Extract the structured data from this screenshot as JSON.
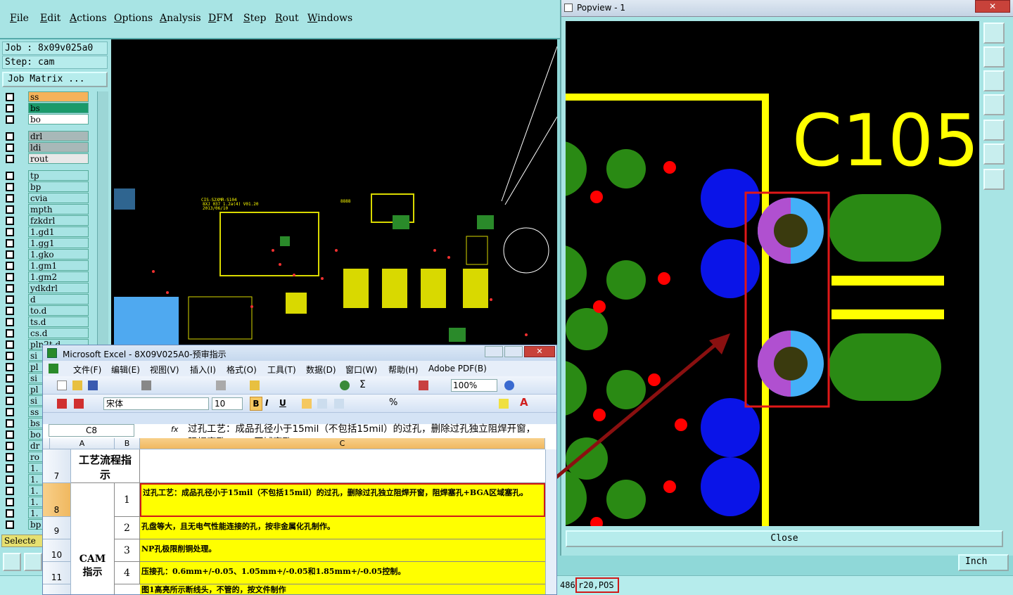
{
  "menu": [
    "File",
    "Edit",
    "Actions",
    "Options",
    "Analysis",
    "DFM",
    "Step",
    "Rout",
    "Windows"
  ],
  "job": {
    "job_label": "Job : 8x09v025a0",
    "step_label": "Step: cam",
    "matrix_button": "Job Matrix ..."
  },
  "layers": [
    {
      "name": "ss",
      "color": "#f5b25a"
    },
    {
      "name": "bs",
      "color": "#1a9a6a"
    },
    {
      "name": "bo",
      "color": "#ffffff"
    },
    {
      "name": "drl",
      "color": "#a8b8b8"
    },
    {
      "name": "ldi",
      "color": "#a8b8b8"
    },
    {
      "name": "rout",
      "color": "#e8e8e8"
    },
    {
      "name": "tp",
      "color": "#a8e4e4"
    },
    {
      "name": "bp",
      "color": "#a8e4e4"
    },
    {
      "name": "cvia",
      "color": "#a8e4e4"
    },
    {
      "name": "mpth",
      "color": "#a8e4e4"
    },
    {
      "name": "fzkdrl",
      "color": "#a8e4e4"
    },
    {
      "name": "1.gd1",
      "color": "#a8e4e4"
    },
    {
      "name": "1.gg1",
      "color": "#a8e4e4"
    },
    {
      "name": "1.gko",
      "color": "#a8e4e4"
    },
    {
      "name": "1.gm1",
      "color": "#a8e4e4"
    },
    {
      "name": "1.gm2",
      "color": "#a8e4e4"
    },
    {
      "name": "ydkdrl",
      "color": "#a8e4e4"
    },
    {
      "name": "d",
      "color": "#a8e4e4"
    },
    {
      "name": "to.d",
      "color": "#a8e4e4"
    },
    {
      "name": "ts.d",
      "color": "#a8e4e4"
    },
    {
      "name": "cs.d",
      "color": "#a8e4e4"
    },
    {
      "name": "pln2t.d",
      "color": "#a8e4e4"
    },
    {
      "name": "si",
      "color": "#a8e4e4"
    },
    {
      "name": "pl",
      "color": "#a8e4e4"
    },
    {
      "name": "si",
      "color": "#a8e4e4"
    },
    {
      "name": "pl",
      "color": "#a8e4e4"
    },
    {
      "name": "si",
      "color": "#a8e4e4"
    },
    {
      "name": "ss",
      "color": "#a8e4e4"
    },
    {
      "name": "bs",
      "color": "#a8e4e4"
    },
    {
      "name": "bo",
      "color": "#a8e4e4"
    },
    {
      "name": "dr",
      "color": "#a8e4e4"
    },
    {
      "name": "ro",
      "color": "#a8e4e4"
    },
    {
      "name": "1.",
      "color": "#a8e4e4"
    },
    {
      "name": "1.",
      "color": "#a8e4e4"
    },
    {
      "name": "1.",
      "color": "#a8e4e4"
    },
    {
      "name": "1.",
      "color": "#a8e4e4"
    },
    {
      "name": "1.",
      "color": "#a8e4e4"
    },
    {
      "name": "bp",
      "color": "#a8e4e4"
    }
  ],
  "selected_label": "Selecte",
  "popview": {
    "title": "Popview - 1",
    "label": "C105",
    "close": "Close",
    "units": "Inch"
  },
  "status": {
    "left": "486",
    "coord": "r20,POS"
  },
  "excel": {
    "title": "Microsoft Excel - 8X09V025A0-预审指示",
    "menu": [
      "文件(F)",
      "编辑(E)",
      "视图(V)",
      "插入(I)",
      "格式(O)",
      "工具(T)",
      "数据(D)",
      "窗口(W)",
      "帮助(H)",
      "Adobe PDF(B)"
    ],
    "zoom": "100%",
    "font": "宋体",
    "size": "10",
    "cellref": "C8",
    "fx": "fx",
    "formula": "过孔工艺：成品孔径小于15mil（不包括15mil）的过孔，删除过孔独立阻焊开窗，阻焊塞孔+BGA区域塞孔。",
    "cols": [
      "A",
      "B",
      "C"
    ],
    "header": "工艺流程指示",
    "group": "CAM指示",
    "rows": [
      {
        "r": "7",
        "n": "",
        "t": ""
      },
      {
        "r": "8",
        "n": "1",
        "t": "过孔工艺：成品孔径小于15mil（不包括15mil）的过孔，删除过孔独立阻焊开窗，阻焊塞孔+BGA区域塞孔。"
      },
      {
        "r": "9",
        "n": "2",
        "t": "孔盘等大，且无电气性能连接的孔，按非金属化孔制作。"
      },
      {
        "r": "10",
        "n": "3",
        "t": "NP孔极限削铜处理。"
      },
      {
        "r": "11",
        "n": "4",
        "t": "压接孔：0.6mm+/-0.05、1.05mm+/-0.05和1.85mm+/-0.05控制。"
      },
      {
        "r": "",
        "n": "",
        "t": "图1高亮所示断线头，不管的，按文件制作"
      }
    ]
  }
}
